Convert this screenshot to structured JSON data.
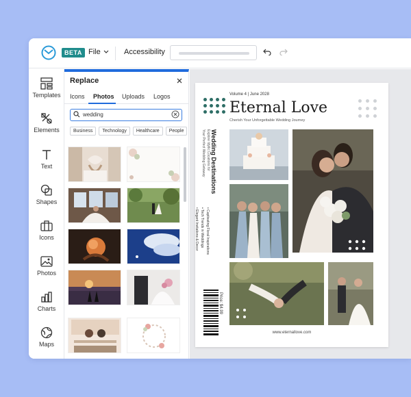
{
  "topbar": {
    "beta_label": "BETA",
    "file_label": "File",
    "accessibility_label": "Accessibility"
  },
  "leftnav": {
    "items": [
      {
        "label": "Templates",
        "icon": "templates-icon"
      },
      {
        "label": "Elements",
        "icon": "elements-icon"
      },
      {
        "label": "Text",
        "icon": "text-icon"
      },
      {
        "label": "Shapes",
        "icon": "shapes-icon"
      },
      {
        "label": "Icons",
        "icon": "icons-icon"
      },
      {
        "label": "Photos",
        "icon": "photos-icon"
      },
      {
        "label": "Charts",
        "icon": "charts-icon"
      },
      {
        "label": "Maps",
        "icon": "maps-icon"
      }
    ]
  },
  "panel": {
    "title": "Replace",
    "tabs": [
      "Icons",
      "Photos",
      "Uploads",
      "Logos"
    ],
    "active_tab": "Photos",
    "search_value": "wedding",
    "chips": [
      "Business",
      "Technology",
      "Healthcare",
      "People"
    ]
  },
  "magazine": {
    "volume": "Volume 4 | June 2028",
    "title": "Eternal Love",
    "subtitle": "Cherish Your Unforgettable Wedding Journey",
    "side_title": "Wedding Destinations",
    "side_sub_1": "Explore Idyllic Locations for",
    "side_sub_2": "Your Perfect Wedding Getaway",
    "bullet_1": "• Captivating Floral Inspirations",
    "bullet_2": "• Tech Trends in Weddings",
    "bullet_3": "• Elegant Invitations & Decor",
    "price": "Price: $4.99",
    "url": "www.eternallove.com"
  },
  "colors": {
    "accent": "#1f6bdc",
    "brand_teal": "#1f8c8c",
    "background": "#a7bdf5",
    "dots_green": "#2e6e66"
  }
}
